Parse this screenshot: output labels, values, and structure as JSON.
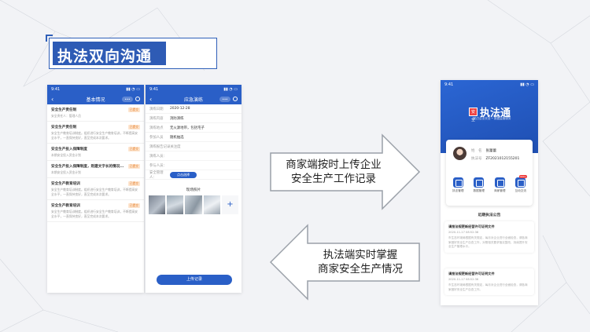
{
  "slide": {
    "title": "执法双向沟通"
  },
  "arrows": {
    "right": {
      "line1": "商家端按时上传企业",
      "line2": "安全生产工作记录"
    },
    "left": {
      "line1": "执法端实时掌握",
      "line2": "商家安全生产情况"
    }
  },
  "phone1": {
    "time": "9:41",
    "title": "基本情况",
    "items": [
      {
        "name": "安全生产责任制",
        "tag": "已提交",
        "desc": "安全责任人：管理人员"
      },
      {
        "name": "安全生产责任制",
        "tag": "已提交",
        "desc": "安全生产教育培训制度。组织进行安全生产教育培训，不断提高安全水平，一直保持良好，直至完成本次要求。"
      },
      {
        "name": "安全生产投入保障制度",
        "tag": "已提交",
        "desc": "本期安全投入资金计划"
      },
      {
        "name": "安全生产投入保障制度，则建文字长的情况...",
        "tag": "已提交",
        "desc": "本期安全投入资金计划"
      },
      {
        "name": "安全生产教育培训",
        "tag": "已提交",
        "desc": "安全生产教育培训制度。组织进行安全生产教育培训，不断提高安全水平，一直保持良好，直至完成本次要求。"
      },
      {
        "name": "安全生产教育培训",
        "tag": "已提交",
        "desc": "安全生产教育培训制度。组织进行安全生产教育培训，不断提高安全水平，一直保持良好，直至完成本次要求。"
      }
    ]
  },
  "phone2": {
    "time": "9:41",
    "title": "应急演练",
    "fields": [
      {
        "label": "演练日期",
        "value": "2020-12-28"
      },
      {
        "label": "演练内容",
        "value": "消防演练"
      },
      {
        "label": "演练地点",
        "value": "无火源地带，包括宅子"
      },
      {
        "label": "参加人员",
        "value": "随机抽选"
      },
      {
        "label": "演练报告记录关注度",
        "value": ""
      },
      {
        "label": "演练人员：",
        "value": ""
      },
      {
        "label": "参与人员：",
        "value": ""
      },
      {
        "label": "安全管理人：",
        "value": ""
      }
    ],
    "choose_btn": "点击选择",
    "photos_title": "现场照片",
    "add": "+",
    "upload": "上传记录"
  },
  "phone3": {
    "time": "9:41",
    "app_name": "执法通",
    "badge": "安全",
    "subtitle": "助力企业安全 • 数据监管服务",
    "name_key": "姓　名",
    "name_val": "张蕾蕾",
    "id_key": "执法号",
    "id_val": "ZF2021012155201",
    "icons": [
      {
        "label": "执法管理"
      },
      {
        "label": "数据管理"
      },
      {
        "label": "商家管理"
      },
      {
        "label": "互动交流",
        "badge": "999+"
      }
    ],
    "notice_title": "近期执法公告",
    "notices": [
      {
        "title": "请按法规更新经营许可证明文件",
        "date": "2020-11-17 08:52:36",
        "body": "市生态环境局根据有关规定，每月对企业进行全面检查，请各商家做好安全生产自查工作，对照相关要求落实整改，持续提升安全生产管理水平。"
      },
      {
        "title": "请按法规更新经营许可证明文件",
        "date": "2020-11-17 08:52:36",
        "body": "市生态环境局根据有关规定，每月对企业进行全面检查，请各商家做好安全生产自查工作。"
      }
    ]
  }
}
